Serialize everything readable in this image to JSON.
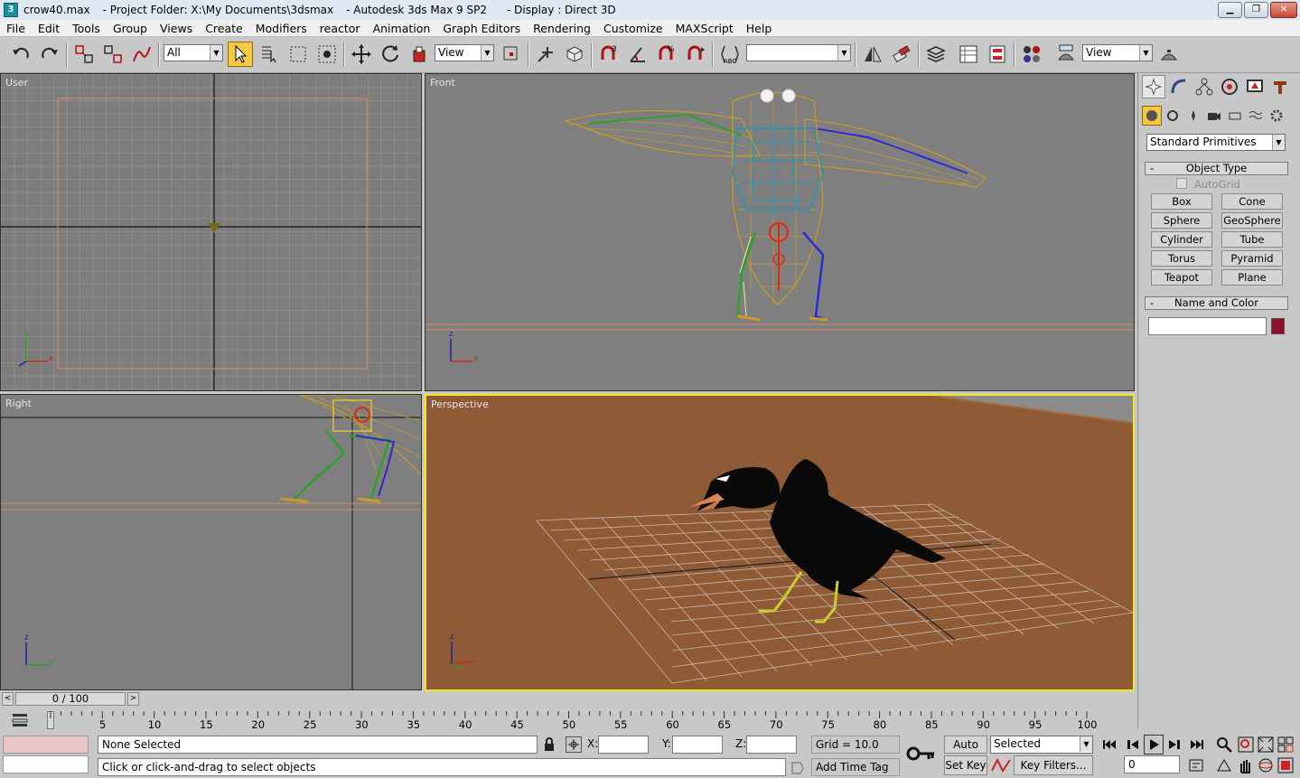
{
  "window": {
    "file": "crow40.max",
    "project": "- Project Folder: X:\\My Documents\\3dsmax",
    "app": "- Autodesk 3ds Max 9 SP2",
    "display": "- Display : Direct 3D",
    "app_icon": "3ds-max-icon",
    "buttons": [
      "minimize",
      "restore",
      "close"
    ]
  },
  "menu": [
    "File",
    "Edit",
    "Tools",
    "Group",
    "Views",
    "Create",
    "Modifiers",
    "reactor",
    "Animation",
    "Graph Editors",
    "Rendering",
    "Customize",
    "MAXScript",
    "Help"
  ],
  "toolbar": {
    "selection_filter": "All",
    "ref_coord": "View",
    "named_selection": "",
    "render_preset": "View"
  },
  "viewports": {
    "top_left": {
      "label": "User"
    },
    "top_right": {
      "label": "Front"
    },
    "bottom_left": {
      "label": "Right"
    },
    "bottom_right": {
      "label": "Perspective"
    }
  },
  "axis": {
    "x": "x",
    "y": "y",
    "z": "z"
  },
  "command_panel": {
    "category": "Standard Primitives",
    "object_type": {
      "header": "Object Type",
      "autogrid": "AutoGrid",
      "buttons": [
        "Box",
        "Cone",
        "Sphere",
        "GeoSphere",
        "Cylinder",
        "Tube",
        "Torus",
        "Pyramid",
        "Teapot",
        "Plane"
      ]
    },
    "name_color": {
      "header": "Name and Color",
      "name": "",
      "color": "#8c0f2e"
    }
  },
  "timeline": {
    "frame": "0 / 100",
    "ticks": [
      "0",
      "5",
      "10",
      "15",
      "20",
      "25",
      "30",
      "35",
      "40",
      "45",
      "50",
      "55",
      "60",
      "65",
      "70",
      "75",
      "80",
      "85",
      "90",
      "95",
      "100"
    ]
  },
  "status": {
    "selection": "None Selected",
    "prompt": "Click or click-and-drag to select objects",
    "x_label": "X:",
    "y_label": "Y:",
    "z_label": "Z:",
    "x_value": "",
    "y_value": "",
    "z_value": "",
    "grid": "Grid = 10.0",
    "add_time_tag": "Add Time Tag",
    "auto_key": "Auto Key",
    "set_key": "Set Key",
    "key_mode": "Selected",
    "key_filters": "Key Filters...",
    "current_frame": "0"
  },
  "colors": {
    "viewport_bg": "#7f7f7f",
    "perspective_bg": "#8e5b36",
    "active_border": "#f0e81a",
    "bone_orange": "#c79a2a",
    "rig_cyan": "#1f9ab8"
  }
}
